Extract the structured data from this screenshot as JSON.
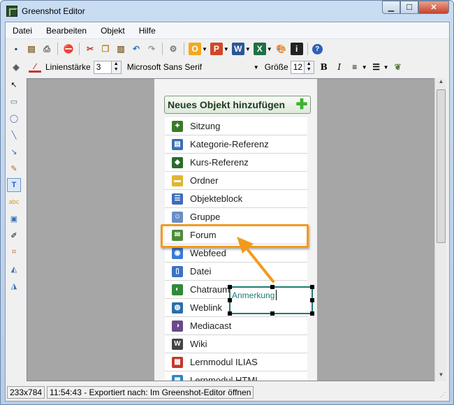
{
  "window": {
    "title": "Greenshot Editor"
  },
  "window_buttons": {
    "minimize": "▁",
    "maximize": "☐",
    "close": "✕"
  },
  "menu": [
    "Datei",
    "Bearbeiten",
    "Objekt",
    "Hilfe"
  ],
  "toolbar1": {
    "icons": [
      "save-icon",
      "clipboard-icon",
      "print-icon",
      "stop-icon",
      "cut-icon",
      "copy-icon",
      "paste-icon",
      "undo-icon",
      "redo-icon",
      "settings-icon",
      "outlook-icon",
      "powerpoint-icon",
      "word-icon",
      "excel-icon",
      "paint-icon",
      "imgur-icon",
      "help-icon"
    ]
  },
  "toolbar2": {
    "line_width_label": "Linienstärke",
    "line_width_value": "3",
    "font_value": "Microsoft Sans Serif",
    "size_label": "Größe",
    "size_value": "12",
    "bold": "B",
    "italic": "I"
  },
  "page": {
    "add_button": "Neues Objekt hinzufügen",
    "items": [
      {
        "label": "Sitzung",
        "icon": "session-icon",
        "color": "#3a7a2a"
      },
      {
        "label": "Kategorie-Referenz",
        "icon": "category-reference-icon",
        "color": "#3b6fb0"
      },
      {
        "label": "Kurs-Referenz",
        "icon": "course-reference-icon",
        "color": "#2c6b2c"
      },
      {
        "label": "Ordner",
        "icon": "folder-icon",
        "color": "#e0b531"
      },
      {
        "label": "Objekteblock",
        "icon": "item-group-icon",
        "color": "#3f6db8"
      },
      {
        "label": "Gruppe",
        "icon": "group-icon",
        "color": "#6a8fc8"
      },
      {
        "label": "Forum",
        "icon": "forum-icon",
        "color": "#4f8a3a"
      },
      {
        "label": "Webfeed",
        "icon": "rss-icon",
        "color": "#3b7bd4"
      },
      {
        "label": "Datei",
        "icon": "file-icon",
        "color": "#3a73c2"
      },
      {
        "label": "Chatraum",
        "icon": "chat-icon",
        "color": "#2f8a3a"
      },
      {
        "label": "Weblink",
        "icon": "weblink-icon",
        "color": "#2b6fa8"
      },
      {
        "label": "Mediacast",
        "icon": "mediacast-icon",
        "color": "#6a4a8a"
      },
      {
        "label": "Wiki",
        "icon": "wiki-icon",
        "color": "#444444"
      },
      {
        "label": "Lernmodul ILIAS",
        "icon": "learning-module-icon",
        "color": "#c0392b"
      },
      {
        "label": "Lernmodul HTML",
        "icon": "html-module-icon",
        "color": "#2e86c1"
      }
    ]
  },
  "annotation": {
    "text": "Anmerkung"
  },
  "status": {
    "dimensions": "233x784",
    "message": "11:54:43 - Exportiert nach: Im Greenshot-Editor öffnen"
  },
  "colors": {
    "highlight": "#f39a1e",
    "textbox_border": "#1f7a73"
  }
}
